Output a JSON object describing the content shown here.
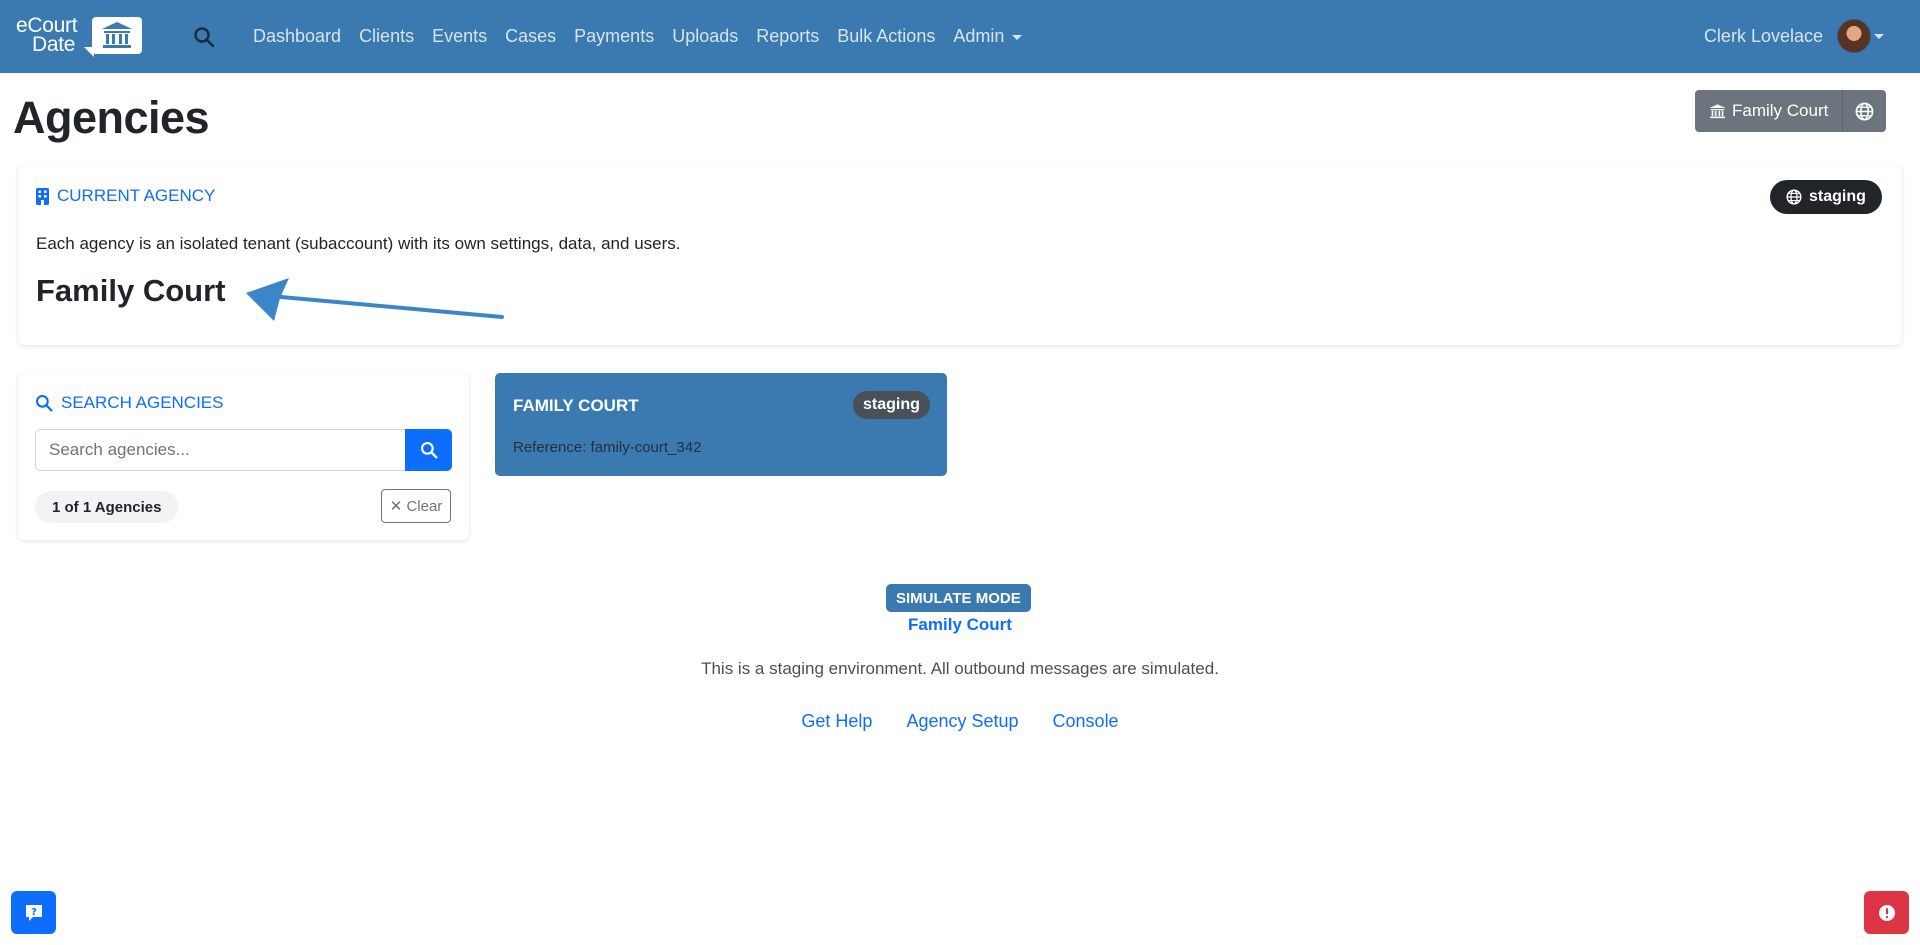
{
  "brand": {
    "line1": "eCourt",
    "line2": "Date",
    "logo_icon": "courthouse-icon"
  },
  "nav": {
    "search_icon": "search-icon",
    "links": [
      "Dashboard",
      "Clients",
      "Events",
      "Cases",
      "Payments",
      "Uploads",
      "Reports",
      "Bulk Actions",
      "Admin"
    ],
    "user_name": "Clerk Lovelace"
  },
  "page": {
    "title": "Agencies",
    "agency_button_label": "Family Court",
    "agency_button_icon": "courthouse-icon",
    "globe_button_icon": "globe-icon"
  },
  "current_agency": {
    "header": "CURRENT AGENCY",
    "header_icon": "building-icon",
    "env_badge": "staging",
    "env_badge_icon": "globe-icon",
    "description": "Each agency is an isolated tenant (subaccount) with its own settings, data, and users.",
    "name": "Family Court"
  },
  "search": {
    "header": "SEARCH AGENCIES",
    "header_icon": "search-icon",
    "placeholder": "Search agencies...",
    "count_label": "1 of 1 Agencies",
    "clear_label": "✕ Clear"
  },
  "agencies": [
    {
      "name": "FAMILY COURT",
      "badge": "staging",
      "reference": "Reference: family-court_342"
    }
  ],
  "footer": {
    "simulate_badge": "SIMULATE MODE",
    "simulate_agency": "Family Court",
    "note": "This is a staging environment. All outbound messages are simulated.",
    "links": [
      "Get Help",
      "Agency Setup",
      "Console"
    ]
  },
  "colors": {
    "navbar": "#3a7ab0",
    "primary": "#0d6efd",
    "danger": "#dc3545",
    "secondary": "#6c757d",
    "dark": "#212529",
    "annotation_arrow": "#3a86c8"
  }
}
